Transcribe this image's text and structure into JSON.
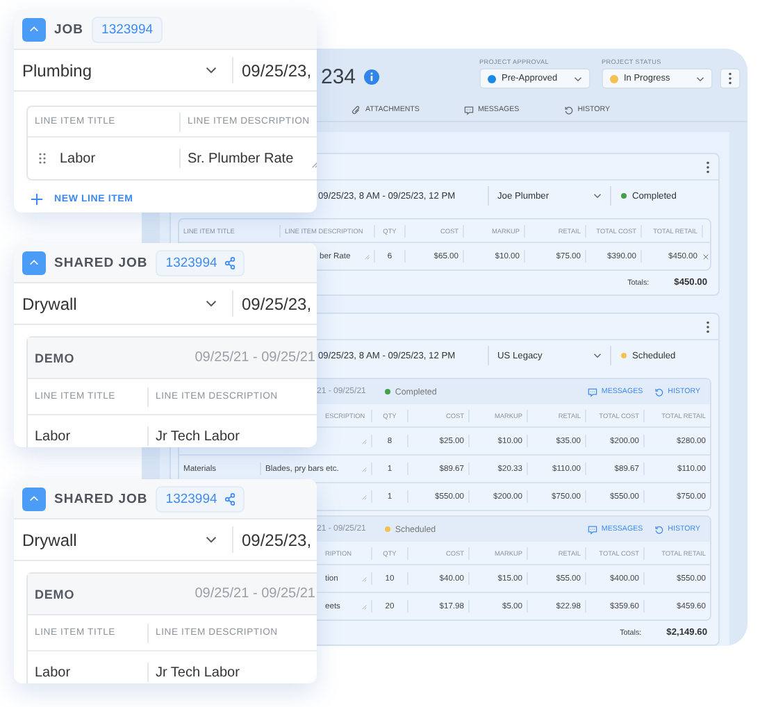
{
  "project": {
    "title": "234",
    "approval": {
      "label": "PROJECT APPROVAL",
      "value": "Pre-Approved",
      "color": "#1e88e5"
    },
    "status": {
      "label": "PROJECT STATUS",
      "value": "In Progress",
      "color": "#f2c14e"
    },
    "tabs": [
      {
        "label": "ATTACHMENTS",
        "kind": "attachments",
        "selected": false
      },
      {
        "label": "MESSAGES",
        "kind": "messages",
        "selected": false
      },
      {
        "label": "HISTORY",
        "kind": "history",
        "selected": false
      }
    ]
  },
  "jobs": [
    {
      "schedule": "09/25/23, 8 AM - 09/25/23, 12 PM",
      "assignee": "Joe Plumber",
      "status": {
        "label": "Completed",
        "color": "#43a047"
      },
      "totals_label": "Totals:",
      "total": "$450.00",
      "sections": [
        {
          "table": {
            "removable": true,
            "columns": [
              "LINE ITEM TITLE",
              "LINE ITEM DESCRIPTION",
              "QTY",
              "COST",
              "MARKUP",
              "RETAIL",
              "TOTAL COST",
              "TOTAL RETAIL"
            ],
            "rows": [
              {
                "description": "ber Rate",
                "qty": "6",
                "cost": "$65.00",
                "markup": "$10.00",
                "retail": "$75.00",
                "total_cost": "$390.00",
                "total_retail": "$450.00"
              }
            ]
          }
        }
      ]
    },
    {
      "schedule": "09/25/23, 8 AM - 09/25/23, 12 PM",
      "assignee": "US Legacy",
      "status": {
        "label": "Scheduled",
        "color": "#f2c14e"
      },
      "totals_label": "Totals:",
      "total": "$2,149.60",
      "sections": [
        {
          "header": {
            "dates": "21 - 09/25/21",
            "status": {
              "label": "Completed",
              "color": "#43a047"
            },
            "links": [
              {
                "label": "MESSAGES",
                "kind": "messages"
              },
              {
                "label": "HISTORY",
                "kind": "history"
              }
            ]
          },
          "table": {
            "removable": false,
            "columns": [
              null,
              "ESCRIPTION",
              "QTY",
              "COST",
              "MARKUP",
              "RETAIL",
              "TOTAL COST",
              "TOTAL RETAIL"
            ],
            "rows": [
              {
                "qty": "8",
                "cost": "$25.00",
                "markup": "$10.00",
                "retail": "$35.00",
                "total_cost": "$200.00",
                "total_retail": "$280.00"
              },
              {
                "title": "Materials",
                "description": "Blades, pry bars etc.",
                "qty": "1",
                "cost": "$89.67",
                "markup": "$20.33",
                "retail": "$110.00",
                "total_cost": "$89.67",
                "total_retail": "$110.00"
              },
              {
                "qty": "1",
                "cost": "$550.00",
                "markup": "$200.00",
                "retail": "$750.00",
                "total_cost": "$550.00",
                "total_retail": "$750.00"
              }
            ]
          }
        },
        {
          "header": {
            "dates": "21 - 09/25/21",
            "status": {
              "label": "Scheduled",
              "color": "#f2c14e"
            },
            "links": [
              {
                "label": "MESSAGES",
                "kind": "messages"
              },
              {
                "label": "HISTORY",
                "kind": "history"
              }
            ]
          },
          "table": {
            "removable": false,
            "columns": [
              null,
              "RIPTION",
              "QTY",
              "COST",
              "MARKUP",
              "RETAIL",
              "TOTAL COST",
              "TOTAL RETAIL"
            ],
            "rows": [
              {
                "description": "tion",
                "qty": "10",
                "cost": "$40.00",
                "markup": "$15.00",
                "retail": "$55.00",
                "total_cost": "$400.00",
                "total_retail": "$550.00"
              },
              {
                "description": "eets",
                "qty": "20",
                "cost": "$17.98",
                "markup": "$5.00",
                "retail": "$22.98",
                "total_cost": "$359.60",
                "total_retail": "$459.60"
              }
            ]
          }
        }
      ]
    }
  ],
  "cards": [
    {
      "label": "JOB",
      "number": "1323994",
      "shared": false,
      "expanded": true,
      "trade": "Plumbing",
      "date": "09/25/23,",
      "line_items": {
        "columns": [
          "LINE ITEM TITLE",
          "LINE ITEM DESCRIPTION"
        ],
        "rows": [
          {
            "title": "Labor",
            "description": "Sr. Plumber Rate",
            "editable": true
          }
        ]
      },
      "add_label": "NEW LINE ITEM"
    },
    {
      "label": "SHARED JOB",
      "number": "1323994",
      "shared": true,
      "expanded": true,
      "trade": "Drywall",
      "date": "09/25/23,",
      "group": {
        "name": "DEMO",
        "dates": "09/25/21 - 09/25/21"
      },
      "line_items": {
        "columns": [
          "LINE ITEM TITLE",
          "LINE ITEM DESCRIPTION"
        ],
        "rows": [
          {
            "title": "Labor",
            "description": "Jr Tech Labor",
            "editable": false
          }
        ]
      }
    },
    {
      "label": "SHARED JOB",
      "number": "1323994",
      "shared": true,
      "expanded": true,
      "trade": "Drywall",
      "date": "09/25/23,",
      "group": {
        "name": "DEMO",
        "dates": "09/25/21 - 09/25/21"
      },
      "line_items": {
        "columns": [
          "LINE ITEM TITLE",
          "LINE ITEM DESCRIPTION"
        ],
        "rows": [
          {
            "title": "Labor",
            "description": "Jr Tech Labor",
            "editable": false
          }
        ]
      }
    }
  ]
}
